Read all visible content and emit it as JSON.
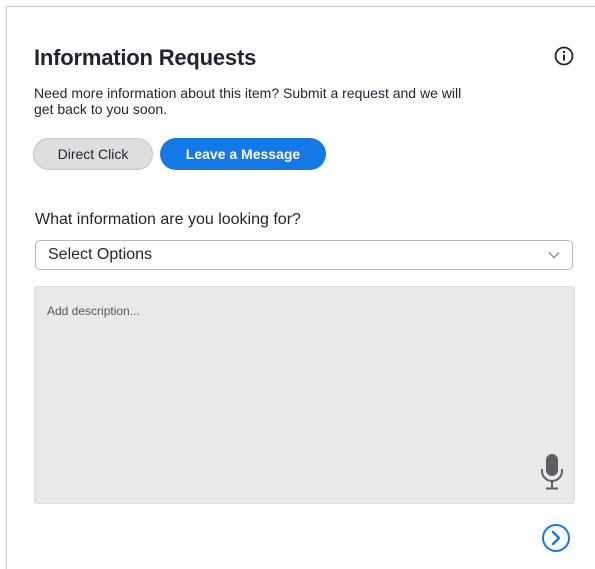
{
  "panel": {
    "title": "Information Requests",
    "subtitle": "Need more information about this item? Submit a request and we will get back to you soon.",
    "info_icon": "info-circle-icon"
  },
  "tabs": {
    "direct_click": "Direct Click",
    "leave_message": "Leave a Message"
  },
  "form": {
    "question": "What information are you looking for?",
    "select_value": "Select Options",
    "select_icon": "chevron-down-icon",
    "description_placeholder": "Add description...",
    "mic_icon": "microphone-icon",
    "next_icon": "arrow-right-circle-icon"
  },
  "colors": {
    "accent": "#1479e6",
    "inactive_button": "#dedee1",
    "textarea_bg": "#e9e9ec"
  }
}
